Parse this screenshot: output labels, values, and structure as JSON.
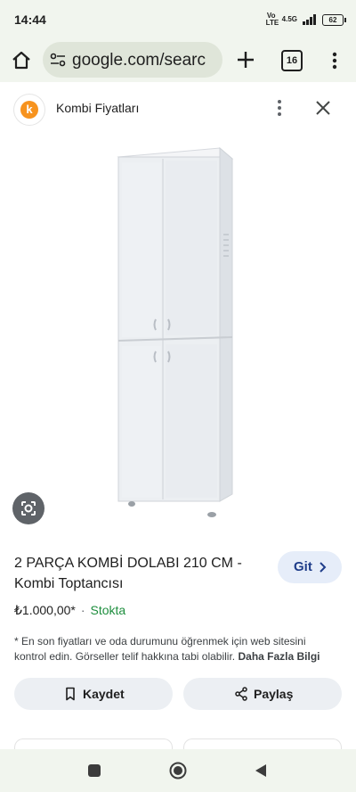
{
  "status_bar": {
    "time": "14:44",
    "network": "4.5G",
    "volte": "Vo LTE",
    "battery": "62"
  },
  "browser": {
    "url": "google.com/searc",
    "tab_count": "16"
  },
  "source": {
    "logo_letter": "k",
    "name": "Kombi Fiyatları"
  },
  "result": {
    "title": "2 PARÇA KOMBİ DOLABI 210 CM - Kombi Toptancısı",
    "go_label": "Git",
    "price": "₺1.000,00*",
    "separator": "·",
    "stock": "Stokta",
    "disclaimer": "* En son fiyatları ve oda durumunu öğrenmek için web sitesini kontrol edin. Görseller telif hakkına tabi olabilir.",
    "more_info": "Daha Fazla Bilgi",
    "save_label": "Kaydet",
    "share_label": "Paylaş"
  },
  "colors": {
    "chrome": "#f1f5ee",
    "omnibox": "#dfe5d9",
    "go_button": "#e6edf9",
    "stock": "#1e8e3e",
    "logo": "#f7931e"
  }
}
